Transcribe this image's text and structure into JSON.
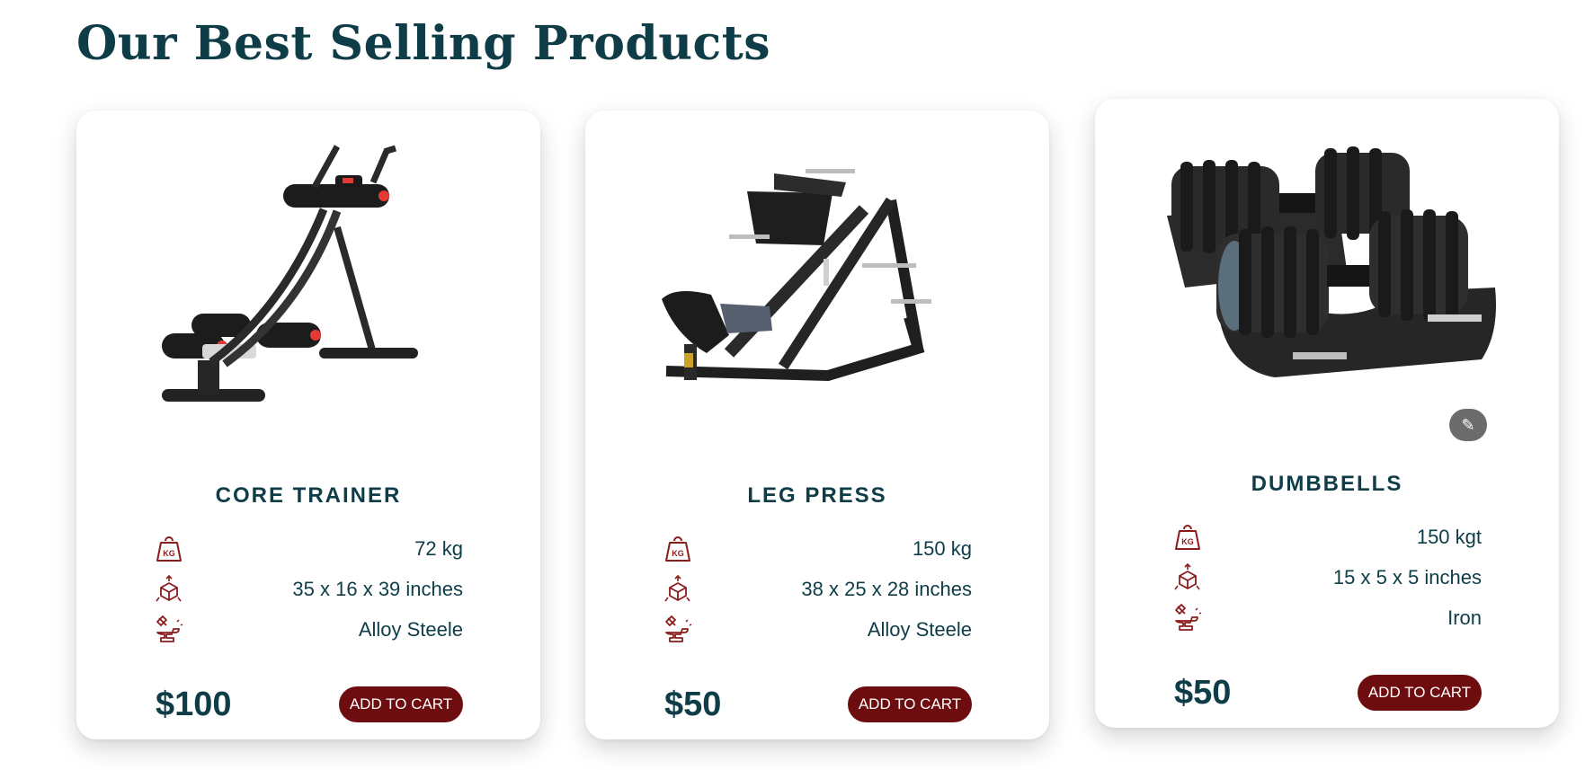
{
  "section_title": "Our Best Selling Products",
  "products": [
    {
      "name": "CORE TRAINER",
      "weight": "72 kg",
      "dimensions": "35 x 16 x 39 inches",
      "material": "Alloy Steele",
      "price": "$100",
      "cart_label": "ADD TO CART",
      "image": "ab-core-trainer-machine-photo"
    },
    {
      "name": "LEG PRESS",
      "weight": "150 kg",
      "dimensions": "38 x 25 x 28 inches",
      "material": "Alloy Steele",
      "price": "$50",
      "cart_label": "ADD TO CART",
      "image": "leg-press-machine-photo"
    },
    {
      "name": "DUMBBELLS",
      "weight": "150 kgt",
      "dimensions": "15 x 5 x 5 inches",
      "material": "Iron",
      "price": "$50",
      "cart_label": "ADD TO CART",
      "image": "adjustable-dumbbells-photo"
    }
  ],
  "icons": {
    "weight": "kg-weight-icon",
    "dimensions": "dimensions-box-icon",
    "material": "anvil-hammer-icon",
    "magic": "magic-wand-icon"
  },
  "colors": {
    "heading": "#0e3d47",
    "accent": "#6e0d0f",
    "icon": "#8a1c1c"
  }
}
